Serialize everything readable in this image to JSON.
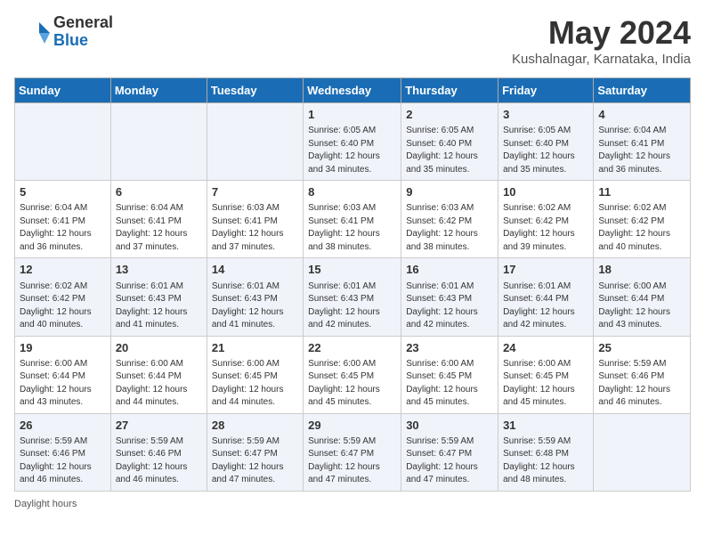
{
  "header": {
    "logo_line1": "General",
    "logo_line2": "Blue",
    "month_title": "May 2024",
    "location": "Kushalnagar, Karnataka, India"
  },
  "days_of_week": [
    "Sunday",
    "Monday",
    "Tuesday",
    "Wednesday",
    "Thursday",
    "Friday",
    "Saturday"
  ],
  "weeks": [
    [
      {
        "day": "",
        "info": ""
      },
      {
        "day": "",
        "info": ""
      },
      {
        "day": "",
        "info": ""
      },
      {
        "day": "1",
        "info": "Sunrise: 6:05 AM\nSunset: 6:40 PM\nDaylight: 12 hours\nand 34 minutes."
      },
      {
        "day": "2",
        "info": "Sunrise: 6:05 AM\nSunset: 6:40 PM\nDaylight: 12 hours\nand 35 minutes."
      },
      {
        "day": "3",
        "info": "Sunrise: 6:05 AM\nSunset: 6:40 PM\nDaylight: 12 hours\nand 35 minutes."
      },
      {
        "day": "4",
        "info": "Sunrise: 6:04 AM\nSunset: 6:41 PM\nDaylight: 12 hours\nand 36 minutes."
      }
    ],
    [
      {
        "day": "5",
        "info": "Sunrise: 6:04 AM\nSunset: 6:41 PM\nDaylight: 12 hours\nand 36 minutes."
      },
      {
        "day": "6",
        "info": "Sunrise: 6:04 AM\nSunset: 6:41 PM\nDaylight: 12 hours\nand 37 minutes."
      },
      {
        "day": "7",
        "info": "Sunrise: 6:03 AM\nSunset: 6:41 PM\nDaylight: 12 hours\nand 37 minutes."
      },
      {
        "day": "8",
        "info": "Sunrise: 6:03 AM\nSunset: 6:41 PM\nDaylight: 12 hours\nand 38 minutes."
      },
      {
        "day": "9",
        "info": "Sunrise: 6:03 AM\nSunset: 6:42 PM\nDaylight: 12 hours\nand 38 minutes."
      },
      {
        "day": "10",
        "info": "Sunrise: 6:02 AM\nSunset: 6:42 PM\nDaylight: 12 hours\nand 39 minutes."
      },
      {
        "day": "11",
        "info": "Sunrise: 6:02 AM\nSunset: 6:42 PM\nDaylight: 12 hours\nand 40 minutes."
      }
    ],
    [
      {
        "day": "12",
        "info": "Sunrise: 6:02 AM\nSunset: 6:42 PM\nDaylight: 12 hours\nand 40 minutes."
      },
      {
        "day": "13",
        "info": "Sunrise: 6:01 AM\nSunset: 6:43 PM\nDaylight: 12 hours\nand 41 minutes."
      },
      {
        "day": "14",
        "info": "Sunrise: 6:01 AM\nSunset: 6:43 PM\nDaylight: 12 hours\nand 41 minutes."
      },
      {
        "day": "15",
        "info": "Sunrise: 6:01 AM\nSunset: 6:43 PM\nDaylight: 12 hours\nand 42 minutes."
      },
      {
        "day": "16",
        "info": "Sunrise: 6:01 AM\nSunset: 6:43 PM\nDaylight: 12 hours\nand 42 minutes."
      },
      {
        "day": "17",
        "info": "Sunrise: 6:01 AM\nSunset: 6:44 PM\nDaylight: 12 hours\nand 42 minutes."
      },
      {
        "day": "18",
        "info": "Sunrise: 6:00 AM\nSunset: 6:44 PM\nDaylight: 12 hours\nand 43 minutes."
      }
    ],
    [
      {
        "day": "19",
        "info": "Sunrise: 6:00 AM\nSunset: 6:44 PM\nDaylight: 12 hours\nand 43 minutes."
      },
      {
        "day": "20",
        "info": "Sunrise: 6:00 AM\nSunset: 6:44 PM\nDaylight: 12 hours\nand 44 minutes."
      },
      {
        "day": "21",
        "info": "Sunrise: 6:00 AM\nSunset: 6:45 PM\nDaylight: 12 hours\nand 44 minutes."
      },
      {
        "day": "22",
        "info": "Sunrise: 6:00 AM\nSunset: 6:45 PM\nDaylight: 12 hours\nand 45 minutes."
      },
      {
        "day": "23",
        "info": "Sunrise: 6:00 AM\nSunset: 6:45 PM\nDaylight: 12 hours\nand 45 minutes."
      },
      {
        "day": "24",
        "info": "Sunrise: 6:00 AM\nSunset: 6:45 PM\nDaylight: 12 hours\nand 45 minutes."
      },
      {
        "day": "25",
        "info": "Sunrise: 5:59 AM\nSunset: 6:46 PM\nDaylight: 12 hours\nand 46 minutes."
      }
    ],
    [
      {
        "day": "26",
        "info": "Sunrise: 5:59 AM\nSunset: 6:46 PM\nDaylight: 12 hours\nand 46 minutes."
      },
      {
        "day": "27",
        "info": "Sunrise: 5:59 AM\nSunset: 6:46 PM\nDaylight: 12 hours\nand 46 minutes."
      },
      {
        "day": "28",
        "info": "Sunrise: 5:59 AM\nSunset: 6:47 PM\nDaylight: 12 hours\nand 47 minutes."
      },
      {
        "day": "29",
        "info": "Sunrise: 5:59 AM\nSunset: 6:47 PM\nDaylight: 12 hours\nand 47 minutes."
      },
      {
        "day": "30",
        "info": "Sunrise: 5:59 AM\nSunset: 6:47 PM\nDaylight: 12 hours\nand 47 minutes."
      },
      {
        "day": "31",
        "info": "Sunrise: 5:59 AM\nSunset: 6:48 PM\nDaylight: 12 hours\nand 48 minutes."
      },
      {
        "day": "",
        "info": ""
      }
    ]
  ],
  "footer": {
    "note": "Daylight hours"
  }
}
